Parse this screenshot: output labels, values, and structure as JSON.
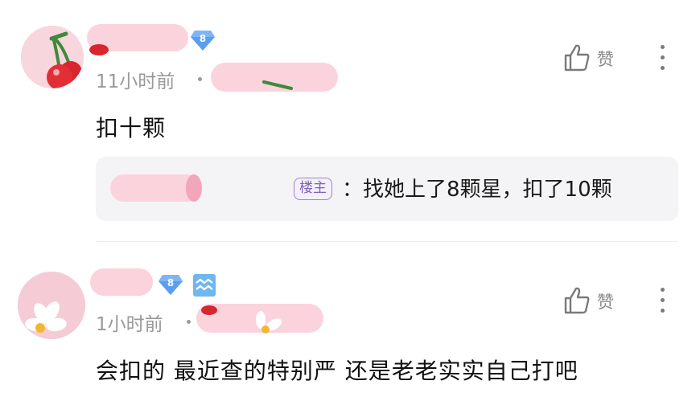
{
  "comments": [
    {
      "level": "8",
      "time": "11小时前",
      "separator": "•",
      "content": "扣十颗",
      "like_label": "赞",
      "reply": {
        "op_tag": "楼主",
        "text": "：找她上了8颗星，扣了10颗"
      }
    },
    {
      "level": "8",
      "time": "1小时前",
      "separator": "•",
      "content": "会扣的 最近查的特别严 还是老老实实自己打吧",
      "like_label": "赞"
    }
  ],
  "icons": {
    "avatar_1": "cherry-avatar",
    "avatar_2": "flower-avatar",
    "level_badge": "diamond-level-icon",
    "zodiac_badge": "aquarius-icon",
    "like": "thumbs-up-icon",
    "more": "more-vertical-icon"
  },
  "colors": {
    "level_badge": "#5b9df0",
    "op_tag": "#7d63b8",
    "zodiac_badge": "#6fb7ee",
    "privacy_blur": "#fbd3dd"
  }
}
